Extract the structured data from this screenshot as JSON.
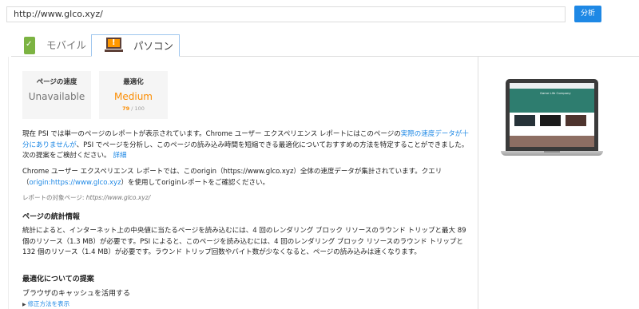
{
  "url_bar": {
    "value": "http://www.glco.xyz/"
  },
  "analyze_button": {
    "label": "分析"
  },
  "tabs": [
    {
      "label": "モバイル",
      "icon": "mobile-pass-icon",
      "active": false
    },
    {
      "label": "パソコン",
      "icon": "desktop-warning-icon",
      "active": true
    }
  ],
  "cards": {
    "speed": {
      "label": "ページの速度",
      "value": "Unavailable"
    },
    "optimization": {
      "label": "最適化",
      "value": "Medium",
      "score": "79",
      "score_suffix": " / 100"
    }
  },
  "paragraph1": {
    "before": "現在 PSI では単一のページのレポートが表示されています。Chrome ユーザー エクスペリエンス レポートにはこのページの",
    "link": "実際の速度データが十分にありませんが",
    "after": "、PSI でページを分析し、このページの読み込み時間を短縮できる最適化についておすすめの方法を特定することができました。次の提案をご検討ください。",
    "details": "詳細"
  },
  "paragraph2": {
    "before": "Chrome ユーザー エクスペリエンス レポートでは、このorigin（https://www.glco.xyz）全体の速度データが集計されています。クエリ（",
    "link": "origin:https://www.glco.xyz",
    "after": "）を使用してoriginレポートをご確認ください。"
  },
  "target": {
    "label": "レポートの対象ページ: ",
    "url": "https://www.glco.xyz/"
  },
  "stats": {
    "heading": "ページの統計情報",
    "text": "統計によると、インターネット上の中央値に当たるページを読み込むには、4 回のレンダリング ブロック リソースのラウンド トリップと最大 89 個のリソース（1.3 MB）が必要です。PSI によると、このページを読み込むには、4 回のレンダリング ブロック リソースのラウンド トリップと 132 個のリソース（1.4 MB）が必要です。ラウンド トリップ回数やバイト数が少なくなると、ページの読み込みは速くなります。"
  },
  "suggestions": {
    "heading": "最適化についての提案",
    "item": "ブラウザのキャッシュを活用する",
    "fix_link": "修正方法を表示"
  },
  "preview": {
    "site_title": "Game Life Company"
  },
  "colors": {
    "accent": "#1e88e5",
    "medium": "#fb8c00",
    "pass": "#7cb342"
  }
}
